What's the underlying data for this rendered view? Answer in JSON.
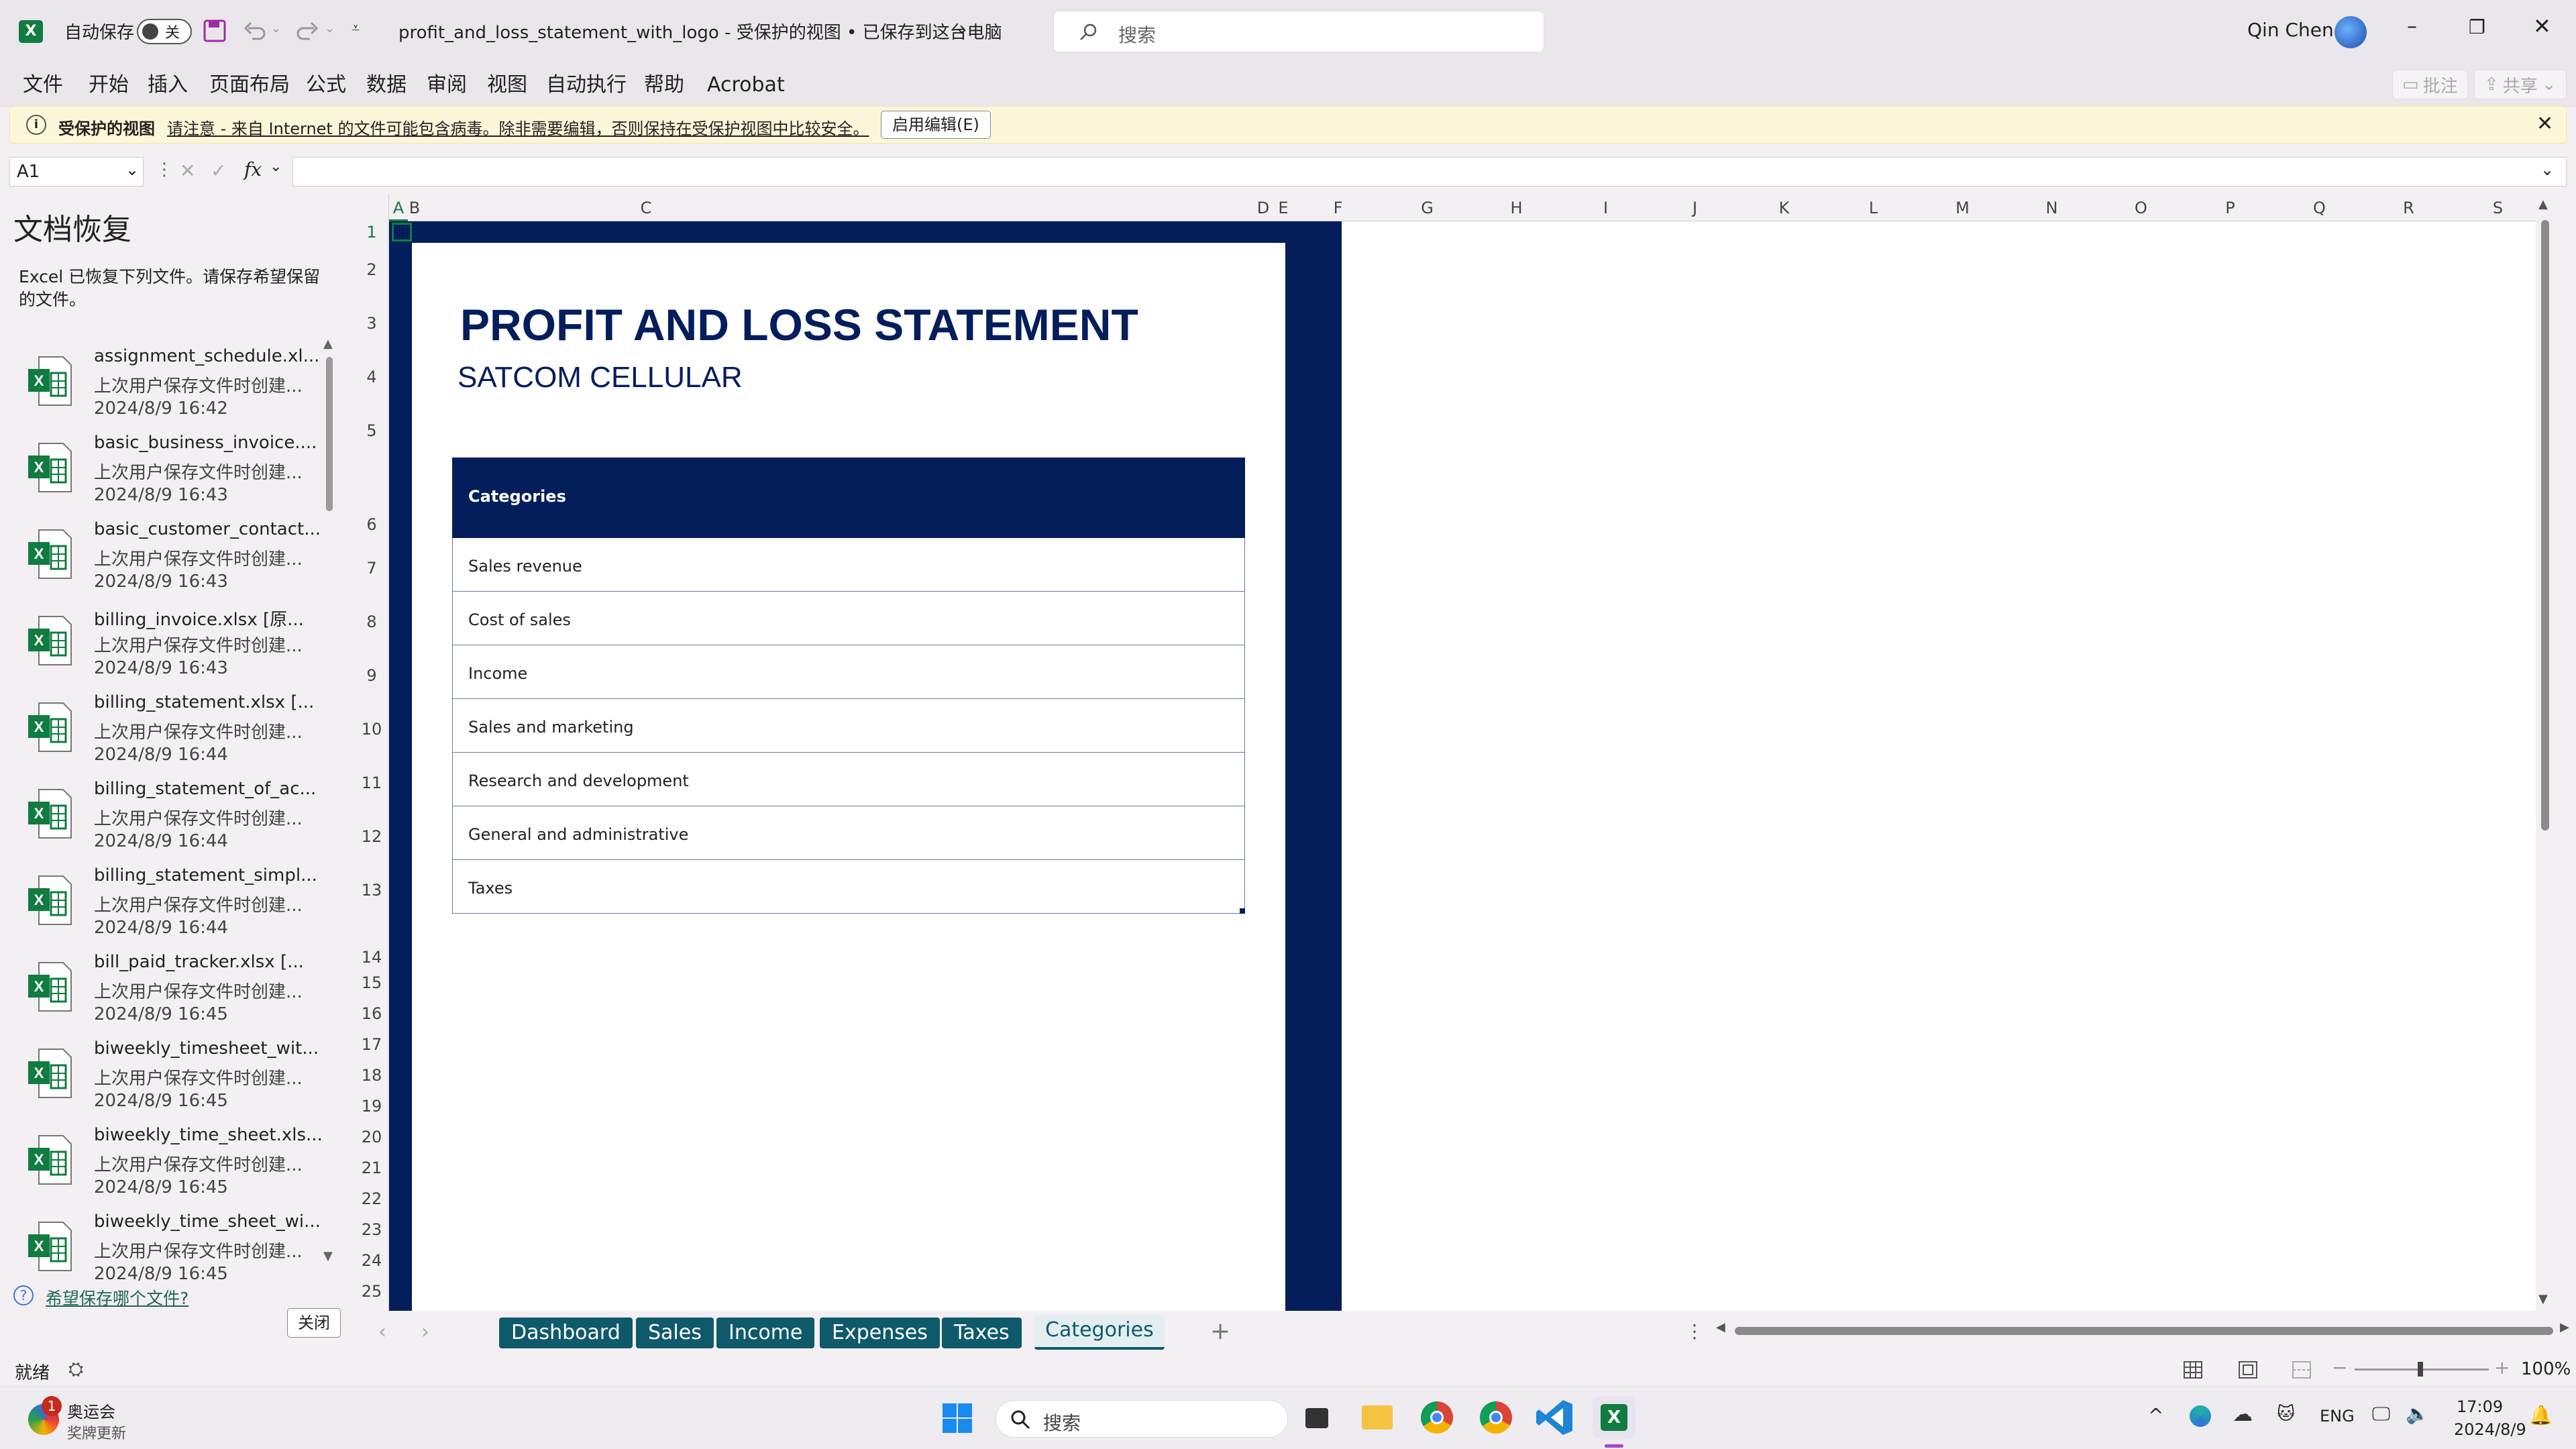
{
  "app": {
    "autosave_label": "自动保存",
    "autosave_state": "关",
    "file_title": "profit_and_loss_statement_with_logo  -  受保护的视图 • 已保存到这台电脑",
    "search_placeholder": "搜索",
    "user_name": "Qin Chen"
  },
  "menu": [
    "文件",
    "开始",
    "插入",
    "页面布局",
    "公式",
    "数据",
    "审阅",
    "视图",
    "自动执行",
    "帮助",
    "Acrobat"
  ],
  "menu_right": {
    "comments": "批注",
    "share": "共享"
  },
  "protected_bar": {
    "title": "受保护的视图",
    "message": "请注意 - 来自 Internet 的文件可能包含病毒。除非需要编辑，否则保持在受保护视图中比较安全。",
    "enable_button": "启用编辑(E)"
  },
  "formula_bar": {
    "name_box": "A1",
    "fx": "fx",
    "value": ""
  },
  "recovery": {
    "title": "文档恢复",
    "description": "Excel 已恢复下列文件。请保存希望保留的文件。",
    "files": [
      {
        "name": "assignment_schedule.xl...",
        "desc": "上次用户保存文件时创建...",
        "time": "2024/8/9 16:42"
      },
      {
        "name": "basic_business_invoice....",
        "desc": "上次用户保存文件时创建...",
        "time": "2024/8/9 16:43"
      },
      {
        "name": "basic_customer_contact...",
        "desc": "上次用户保存文件时创建...",
        "time": "2024/8/9 16:43"
      },
      {
        "name": "billing_invoice.xlsx  [原...",
        "desc": "上次用户保存文件时创建...",
        "time": "2024/8/9 16:43"
      },
      {
        "name": "billing_statement.xlsx  [...",
        "desc": "上次用户保存文件时创建...",
        "time": "2024/8/9 16:44"
      },
      {
        "name": "billing_statement_of_ac...",
        "desc": "上次用户保存文件时创建...",
        "time": "2024/8/9 16:44"
      },
      {
        "name": "billing_statement_simpl...",
        "desc": "上次用户保存文件时创建...",
        "time": "2024/8/9 16:44"
      },
      {
        "name": "bill_paid_tracker.xlsx  [...",
        "desc": "上次用户保存文件时创建...",
        "time": "2024/8/9 16:45"
      },
      {
        "name": "biweekly_timesheet_wit...",
        "desc": "上次用户保存文件时创建...",
        "time": "2024/8/9 16:45"
      },
      {
        "name": "biweekly_time_sheet.xls...",
        "desc": "上次用户保存文件时创建...",
        "time": "2024/8/9 16:45"
      },
      {
        "name": "biweekly_time_sheet_wi...",
        "desc": "上次用户保存文件时创建...",
        "time": "2024/8/9 16:45"
      }
    ],
    "help_link": "希望保存哪个文件?",
    "close_button": "关闭"
  },
  "sheet": {
    "columns": [
      "A",
      "B",
      "C",
      "D",
      "E",
      "F",
      "G",
      "H",
      "I",
      "J",
      "K",
      "L",
      "M",
      "N",
      "O",
      "P",
      "Q",
      "R",
      "S"
    ],
    "rows": [
      "1",
      "2",
      "3",
      "4",
      "5",
      "6",
      "7",
      "8",
      "9",
      "10",
      "11",
      "12",
      "13",
      "14",
      "15",
      "16",
      "17",
      "18",
      "19",
      "20",
      "21",
      "22",
      "23",
      "24",
      "25"
    ],
    "title": "PROFIT AND LOSS STATEMENT",
    "company": "SATCOM CELLULAR",
    "table_header": "Categories",
    "categories": [
      "Sales revenue",
      "Cost of sales",
      "Income",
      "Sales and marketing",
      "Research and development",
      "General and administrative",
      "Taxes"
    ]
  },
  "tabs": [
    "Dashboard",
    "Sales",
    "Income",
    "Expenses",
    "Taxes",
    "Categories"
  ],
  "active_tab": "Categories",
  "status": {
    "ready": "就绪",
    "zoom": "100%"
  },
  "taskbar": {
    "weather_title": "奥运会",
    "weather_sub": "奖牌更新",
    "badge": "1",
    "search": "搜索",
    "lang": "ENG",
    "time": "17:09",
    "date": "2024/8/9"
  },
  "colors": {
    "navy": "#041e5c",
    "tab_teal": "#0e5a6b",
    "excel_green": "#107c41"
  }
}
